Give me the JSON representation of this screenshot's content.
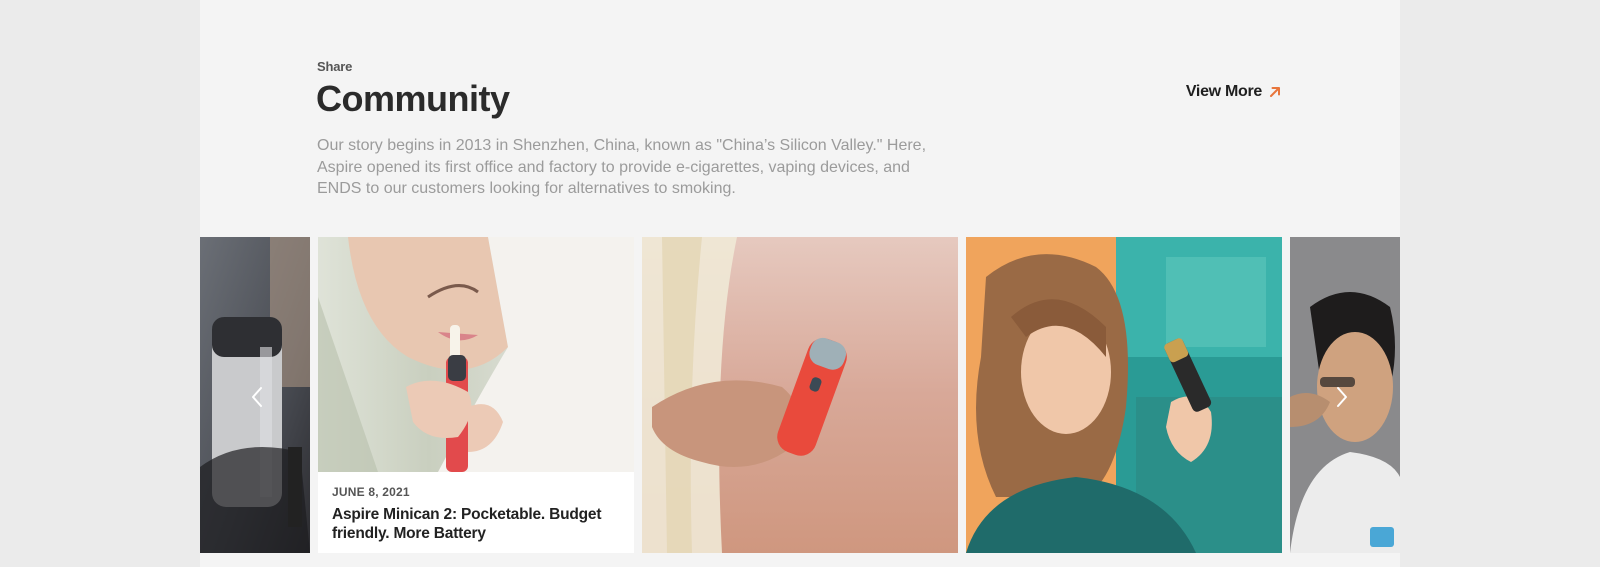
{
  "section": {
    "eyebrow": "Share",
    "title": "Community",
    "description": "Our story begins in 2013 in Shenzhen, China, known as \"China’s Silicon Valley.\" Here, Aspire opened its first office and factory to provide e-cigarettes, vaping devices, and ENDS to our customers looking for alternatives to smoking.",
    "view_more_label": "View More",
    "accent_color": "#e8763c"
  },
  "carousel": {
    "featured_card": {
      "date": "JUNE 8, 2021",
      "title": "Aspire Minican 2: Pocketable. Budget friendly. More Battery"
    },
    "prev_icon": "chevron-left-icon",
    "next_icon": "chevron-right-icon"
  }
}
